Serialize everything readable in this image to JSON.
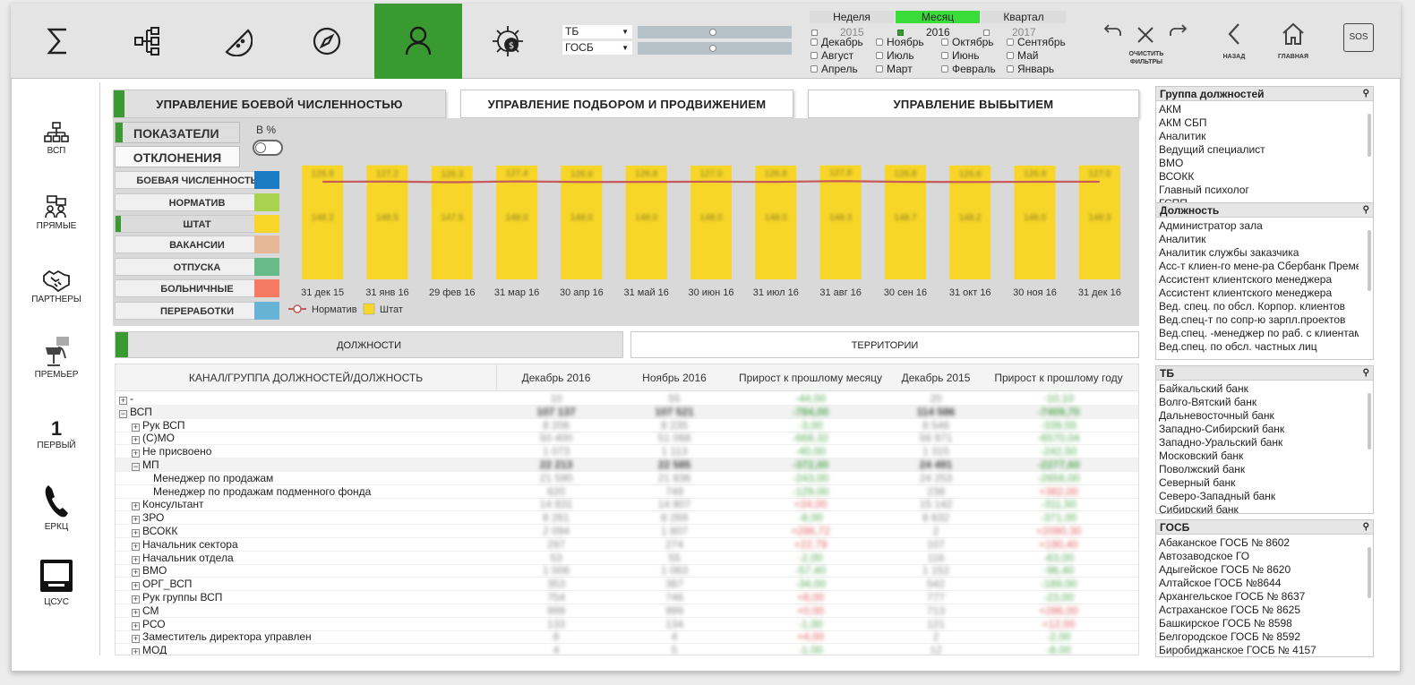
{
  "top": {
    "tb_label": "ТБ",
    "gosb_label": "ГОСБ",
    "periods": [
      "Неделя",
      "Месяц",
      "Квартал"
    ],
    "years": [
      "2015",
      "2016",
      "2017"
    ],
    "months": [
      [
        "Декабрь",
        "Ноябрь",
        "Октябрь",
        "Сентябрь"
      ],
      [
        "Август",
        "Июль",
        "Июнь",
        "Май"
      ],
      [
        "Апрель",
        "Март",
        "Февраль",
        "Январь"
      ]
    ],
    "clear_label": "ОЧИСТИТЬ\nФИЛЬТРЫ",
    "back_label": "НАЗАД",
    "home_label": "ГЛАВНАЯ",
    "sos_label": "SOS",
    "accent": "#3a9a32"
  },
  "sidebar": [
    {
      "label": "ВСП",
      "icon": "org-chart-icon"
    },
    {
      "label": "ПРЯМЫЕ",
      "icon": "direct-sales-icon"
    },
    {
      "label": "ПАРТНЕРЫ",
      "icon": "handshake-icon"
    },
    {
      "label": "ПРЕМЬЕР",
      "icon": "premier-icon"
    },
    {
      "label": "ПЕРВЫЙ",
      "icon": "number-one-icon",
      "glyph": "1"
    },
    {
      "label": "ЕРКЦ",
      "icon": "phone-icon"
    },
    {
      "label": "ЦСУС",
      "icon": "monitor-icon"
    }
  ],
  "tabs": [
    "УПРАВЛЕНИЕ БОЕВОЙ ЧИСЛЕННОСТЬЮ",
    "УПРАВЛЕНИЕ ПОДБОРОМ И ПРОДВИЖЕНИЕМ",
    "УПРАВЛЕНИЕ ВЫБЫТИЕМ"
  ],
  "panel": {
    "indicators": "ПОКАЗАТЕЛИ",
    "deviations": "ОТКЛОНЕНИЯ",
    "pct": "В %"
  },
  "legend": [
    {
      "label": "БОЕВАЯ ЧИСЛЕННОСТЬ",
      "color": "#1b7cc3"
    },
    {
      "label": "НОРМАТИВ",
      "color": "#a9d24f"
    },
    {
      "label": "ШТАТ",
      "color": "#f7d629"
    },
    {
      "label": "ВАКАНСИИ",
      "color": "#e6b898"
    },
    {
      "label": "ОТПУСКА",
      "color": "#66bb88"
    },
    {
      "label": "БОЛЬНИЧНЫЕ",
      "color": "#f47a62"
    },
    {
      "label": "ПЕРЕРАБОТКИ",
      "color": "#66b3d6"
    }
  ],
  "chart_data": {
    "type": "bar",
    "categories": [
      "31 дек 15",
      "31 янв 16",
      "29 фев 16",
      "31 мар 16",
      "30 апр 16",
      "31 май 16",
      "30 июн 16",
      "31 июл 16",
      "31 авг 16",
      "30 сен 16",
      "31 окт 16",
      "30 ноя 16",
      "31 дек 16"
    ],
    "series": [
      {
        "name": "Штат",
        "kind": "bar",
        "color": "#f7d629",
        "values": [
          148.2,
          148.5,
          147.5,
          148.0,
          148.0,
          148.0,
          148.0,
          148.0,
          148.3,
          148.7,
          148.2,
          148.0,
          148.3
        ]
      },
      {
        "name": "Норматив",
        "kind": "line",
        "color": "#c85a5a",
        "values": [
          126.9,
          127.2,
          126.3,
          127.4,
          126.6,
          126.8,
          127.0,
          126.8,
          127.8,
          126.8,
          126.6,
          126.9,
          127.0
        ]
      }
    ],
    "legend": [
      "Норматив",
      "Штат"
    ],
    "ylim": [
      0,
      170
    ]
  },
  "subtabs": [
    "ДОЛЖНОСТИ",
    "ТЕРРИТОРИИ"
  ],
  "table": {
    "headers": [
      "КАНАЛ/ГРУППА ДОЛЖНОСТЕЙ/ДОЛЖНОСТЬ",
      "Декабрь 2016",
      "Ноябрь 2016",
      "Прирост к прошлому месяцу",
      "Декабрь 2015",
      "Прирост к прошлому году"
    ],
    "rows": [
      {
        "label": "-",
        "lvl": 0,
        "pm": "+",
        "v": [
          "10",
          "55",
          "-44,00",
          "20",
          "-10,10"
        ],
        "c": [
          "",
          "",
          "g",
          "",
          "g"
        ]
      },
      {
        "label": "ВСП",
        "lvl": 0,
        "pm": "−",
        "v": [
          "107 137",
          "107 521",
          "-784,00",
          "114 586",
          "-7409,70"
        ],
        "c": [
          "",
          "",
          "g",
          "",
          "g"
        ],
        "bold": true
      },
      {
        "label": "Рук ВСП",
        "lvl": 1,
        "pm": "+",
        "v": [
          "8 206",
          "8 235",
          "-3,00",
          "8 546",
          "-339,55"
        ],
        "c": [
          "",
          "",
          "g",
          "",
          "g"
        ]
      },
      {
        "label": "(С)МО",
        "lvl": 1,
        "pm": "+",
        "v": [
          "50 400",
          "51 068",
          "-668,32",
          "56 971",
          "-6570,04"
        ],
        "c": [
          "",
          "",
          "g",
          "",
          "g"
        ]
      },
      {
        "label": "Не присвоено",
        "lvl": 1,
        "pm": "+",
        "v": [
          "1 073",
          "1 113",
          "-40,00",
          "1 315",
          "-242,50"
        ],
        "c": [
          "",
          "",
          "g",
          "",
          "g"
        ]
      },
      {
        "label": "МП",
        "lvl": 1,
        "pm": "−",
        "v": [
          "22 213",
          "22 585",
          "-372,00",
          "24 491",
          "-2277,60"
        ],
        "c": [
          "",
          "",
          "g",
          "",
          "g"
        ],
        "bold": true
      },
      {
        "label": "Менеджер по продажам",
        "lvl": 2,
        "pm": "",
        "v": [
          "21 590",
          "21 836",
          "-243,00",
          "24 253",
          "-2656,00"
        ],
        "c": [
          "",
          "",
          "g",
          "",
          "g"
        ]
      },
      {
        "label": "Менеджер по продажам подменного фонда",
        "lvl": 2,
        "pm": "",
        "v": [
          "620",
          "749",
          "-129,00",
          "238",
          "+382,00"
        ],
        "c": [
          "",
          "",
          "g",
          "",
          "r"
        ]
      },
      {
        "label": "Консультант",
        "lvl": 1,
        "pm": "+",
        "v": [
          "14 831",
          "14 807",
          "+24,00",
          "15 142",
          "-311,50"
        ],
        "c": [
          "",
          "",
          "r",
          "",
          "g"
        ]
      },
      {
        "label": "ЗРО",
        "lvl": 1,
        "pm": "+",
        "v": [
          "8 261",
          "8 269",
          "-8,00",
          "8 632",
          "-371,00"
        ],
        "c": [
          "",
          "",
          "g",
          "",
          "g"
        ]
      },
      {
        "label": "ВСОКК",
        "lvl": 1,
        "pm": "+",
        "v": [
          "2 094",
          "1 807",
          "+286,72",
          "2",
          "+2090,30"
        ],
        "c": [
          "",
          "",
          "r",
          "",
          "r"
        ]
      },
      {
        "label": "Начальник сектора",
        "lvl": 1,
        "pm": "+",
        "v": [
          "297",
          "274",
          "+22,79",
          "107",
          "+190,40"
        ],
        "c": [
          "",
          "",
          "r",
          "",
          "r"
        ]
      },
      {
        "label": "Начальник отдела",
        "lvl": 1,
        "pm": "+",
        "v": [
          "53",
          "55",
          "-2,00",
          "116",
          "-63,00"
        ],
        "c": [
          "",
          "",
          "g",
          "",
          "g"
        ]
      },
      {
        "label": "ВМО",
        "lvl": 1,
        "pm": "+",
        "v": [
          "1 006",
          "1 063",
          "-57,40",
          "1 152",
          "-96,40"
        ],
        "c": [
          "",
          "",
          "g",
          "",
          "g"
        ]
      },
      {
        "label": "ОРГ_ВСП",
        "lvl": 1,
        "pm": "+",
        "v": [
          "353",
          "387",
          "-34,00",
          "542",
          "-189,00"
        ],
        "c": [
          "",
          "",
          "g",
          "",
          "g"
        ]
      },
      {
        "label": "Рук группы ВСП",
        "lvl": 1,
        "pm": "+",
        "v": [
          "754",
          "746",
          "+8,00",
          "777",
          "-23,00"
        ],
        "c": [
          "",
          "",
          "r",
          "",
          "g"
        ]
      },
      {
        "label": "СМ",
        "lvl": 1,
        "pm": "+",
        "v": [
          "999",
          "999",
          "+0,00",
          "713",
          "+286,00"
        ],
        "c": [
          "",
          "",
          "r",
          "",
          "r"
        ]
      },
      {
        "label": "РСО",
        "lvl": 1,
        "pm": "+",
        "v": [
          "133",
          "134",
          "-1,00",
          "121",
          "+12,00"
        ],
        "c": [
          "",
          "",
          "g",
          "",
          "r"
        ]
      },
      {
        "label": "Заместитель директора управлен",
        "lvl": 1,
        "pm": "+",
        "v": [
          "8",
          "4",
          "+4,00",
          "2",
          "-2,00"
        ],
        "c": [
          "",
          "",
          "r",
          "",
          "g"
        ]
      },
      {
        "label": "МОД",
        "lvl": 1,
        "pm": "+",
        "v": [
          "4",
          "5",
          "-1,00",
          "12",
          "-8,00"
        ],
        "c": [
          "",
          "",
          "g",
          "",
          "g"
        ]
      }
    ]
  },
  "filters": [
    {
      "title": "Группа должностей",
      "items": [
        "АКМ",
        "АКМ СБП",
        "Аналитик",
        "Ведущий специалист",
        "ВМО",
        "ВСОКК",
        "Главный психолог",
        "ГСПП"
      ]
    },
    {
      "title": "Должность",
      "items": [
        "Администратор зала",
        "Аналитик",
        "Аналитик службы заказчика",
        "Асс-т клиен-го мене-ра Сбербанк Преме",
        "Ассистент клиентского менеджера",
        "Ассистент клиентского менеджера",
        "Вед. спец. по обсл. Корпор. клиентов",
        "Вед.спец-т по сопр-ю зарпл.проектов",
        "Вед.спец. -менеджер по раб. с клиентам",
        "Вед.спец. по обсл. частных лиц"
      ]
    },
    {
      "title": "ТБ",
      "items": [
        "Байкальский банк",
        "Волго-Вятский банк",
        "Дальневосточный банк",
        "Западно-Сибирский банк",
        "Западно-Уральский банк",
        "Московский банк",
        "Поволжский банк",
        "Северный банк",
        "Северо-Западный банк",
        "Сибирский банк"
      ]
    },
    {
      "title": "ГОСБ",
      "items": [
        "Абаканское ГОСБ № 8602",
        "Автозаводское ГО",
        "Адыгейское ГОСБ № 8620",
        "Алтайское ГОСБ №8644",
        "Архангельское ГОСБ № 8637",
        "Астраханское ГОСБ № 8625",
        "Башкирское ГОСБ № 8598",
        "Белгородское ГОСБ № 8592",
        "Биробиджанское ГОСБ № 4157"
      ]
    }
  ]
}
